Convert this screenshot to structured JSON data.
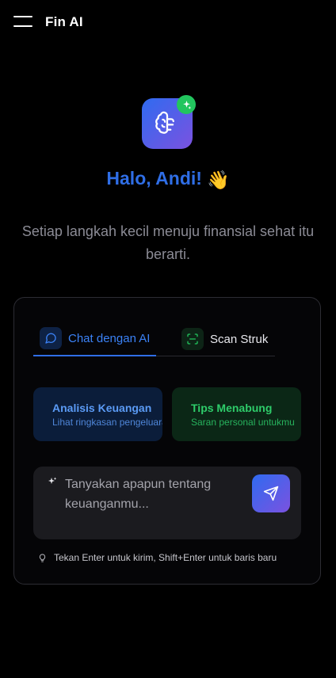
{
  "header": {
    "title": "Fin AI",
    "menu_icon": "hamburger-menu-icon"
  },
  "hero": {
    "logo_icon": "brain-icon",
    "badge_icon": "sparkle-icon",
    "greeting": "Halo, Andi!",
    "greeting_emoji": "👋",
    "subtitle": "Setiap langkah kecil menuju finansial sehat itu berarti."
  },
  "tabs": [
    {
      "label": "Chat dengan AI",
      "icon": "chat-bubble-icon",
      "active": true
    },
    {
      "label": "Scan Struk",
      "icon": "scan-icon",
      "active": false
    }
  ],
  "suggestions": [
    {
      "title": "Analisis Keuangan",
      "subtitle": "Lihat ringkasan pengeluaran"
    },
    {
      "title": "Tips Menabung",
      "subtitle": "Saran personal untukmu"
    }
  ],
  "input": {
    "placeholder": "Tanyakan apapun tentang keuanganmu...",
    "send_icon": "send-icon"
  },
  "hint": {
    "text": "Tekan Enter untuk kirim, Shift+Enter untuk baris baru",
    "icon": "lightbulb-icon"
  },
  "colors": {
    "accent_blue": "#2f6ee6",
    "accent_purple": "#7b52e0",
    "green": "#22c55e",
    "background": "#000000"
  }
}
